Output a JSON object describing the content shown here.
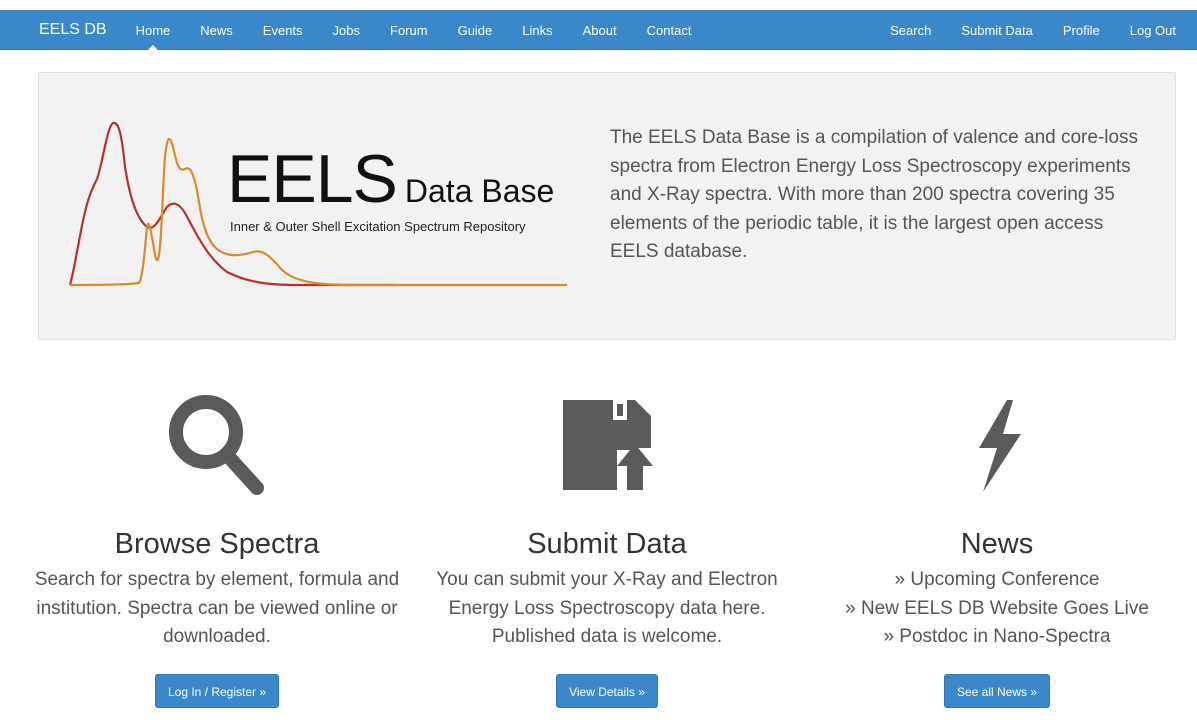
{
  "nav": {
    "brand": "EELS DB",
    "left_items": [
      "Home",
      "News",
      "Events",
      "Jobs",
      "Forum",
      "Guide",
      "Links",
      "About",
      "Contact"
    ],
    "right_items": [
      "Search",
      "Submit Data",
      "Profile",
      "Log Out"
    ],
    "active": "Home"
  },
  "hero": {
    "logo_title": "EELS",
    "logo_title_suffix": "Data Base",
    "logo_subtitle": "Inner & Outer Shell Excitation Spectrum Repository",
    "intro": "The EELS Data Base is a compilation of valence and core-loss spectra from Electron Energy Loss Spectroscopy experiments and X-Ray spectra. With more than 200 spectra covering 35 elements of the periodic table, it is the largest open access EELS database."
  },
  "columns": [
    {
      "icon": "search-icon",
      "title": "Browse Spectra",
      "text": "Search for spectra by element, formula and institution. Spectra can be viewed online or downloaded.",
      "button": "Log In / Register »"
    },
    {
      "icon": "floppy-upload-icon",
      "title": "Submit Data",
      "text": "You can submit your X-Ray and Electron Energy Loss Spectroscopy data here. Published data is welcome.",
      "button": "View Details »"
    },
    {
      "icon": "lightning-icon",
      "title": "News",
      "news": [
        "» Upcoming Conference",
        "» New EELS DB Website Goes Live",
        "» Postdoc in Nano-Spectra"
      ],
      "button": "See all News »"
    }
  ],
  "colors": {
    "navbar": "#3a87c9",
    "icon": "#5a5a5a",
    "spectrum_red": "#b8312a",
    "spectrum_orange": "#d98a2b"
  }
}
